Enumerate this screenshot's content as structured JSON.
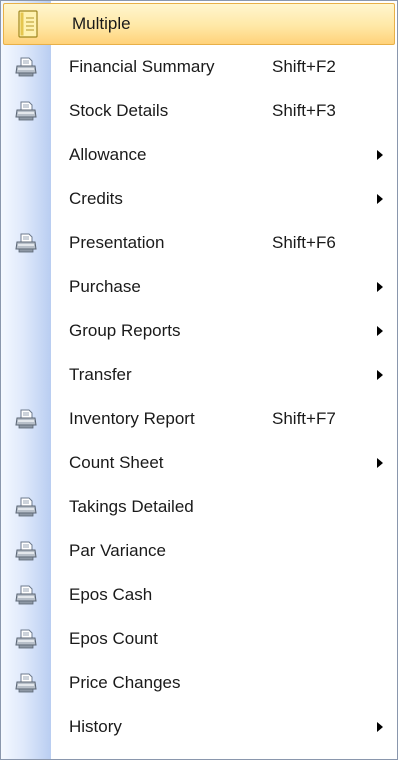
{
  "menu": {
    "items": [
      {
        "label": "Multiple",
        "shortcut": "",
        "icon": "notebook-icon",
        "submenu": false,
        "highlighted": true
      },
      {
        "label": "Financial Summary",
        "shortcut": "Shift+F2",
        "icon": "printer-icon",
        "submenu": false
      },
      {
        "label": "Stock Details",
        "shortcut": "Shift+F3",
        "icon": "printer-icon",
        "submenu": false
      },
      {
        "label": "Allowance",
        "shortcut": "",
        "icon": "",
        "submenu": true
      },
      {
        "label": "Credits",
        "shortcut": "",
        "icon": "",
        "submenu": true
      },
      {
        "label": "Presentation",
        "shortcut": "Shift+F6",
        "icon": "printer-icon",
        "submenu": false
      },
      {
        "label": "Purchase",
        "shortcut": "",
        "icon": "",
        "submenu": true
      },
      {
        "label": "Group Reports",
        "shortcut": "",
        "icon": "",
        "submenu": true
      },
      {
        "label": "Transfer",
        "shortcut": "",
        "icon": "",
        "submenu": true
      },
      {
        "label": "Inventory Report",
        "shortcut": "Shift+F7",
        "icon": "printer-icon",
        "submenu": false
      },
      {
        "label": "Count Sheet",
        "shortcut": "",
        "icon": "",
        "submenu": true
      },
      {
        "label": "Takings Detailed",
        "shortcut": "",
        "icon": "printer-icon",
        "submenu": false
      },
      {
        "label": "Par Variance",
        "shortcut": "",
        "icon": "printer-icon",
        "submenu": false
      },
      {
        "label": "Epos Cash",
        "shortcut": "",
        "icon": "printer-icon",
        "submenu": false
      },
      {
        "label": "Epos Count",
        "shortcut": "",
        "icon": "printer-icon",
        "submenu": false
      },
      {
        "label": "Price Changes",
        "shortcut": "",
        "icon": "printer-icon",
        "submenu": false
      },
      {
        "label": "History",
        "shortcut": "",
        "icon": "",
        "submenu": true
      }
    ]
  },
  "colors": {
    "highlight": "#ffe8a6",
    "highlight_border": "#e8b048",
    "gutter": "#dfe9fb",
    "border": "#8a97ad",
    "text": "#1a1a1a"
  }
}
